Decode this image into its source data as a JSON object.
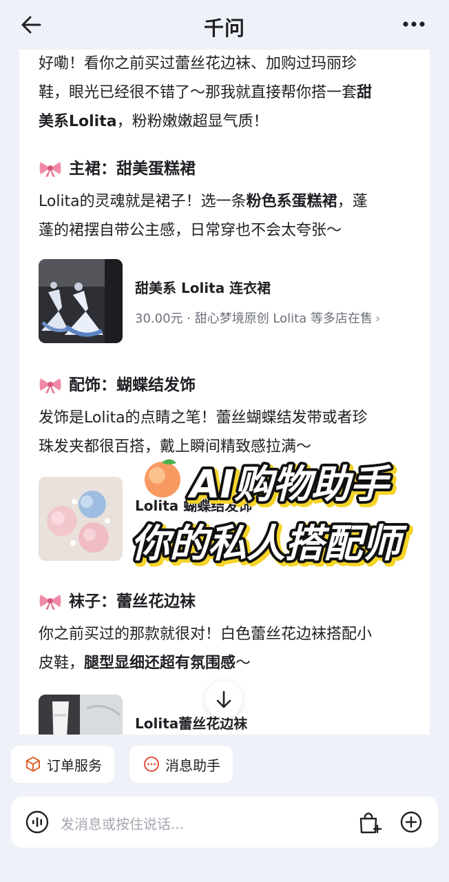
{
  "header": {
    "title": "千问"
  },
  "chat": {
    "intro_1": "好嘞！看你之前买过蕾丝花边袜、加购过玛丽珍",
    "intro_2a": "鞋，眼光已经很不错了～那我就直接帮你搭一套",
    "intro_2b": "甜",
    "intro_3a": "美系Lolita",
    "intro_3b": "，粉粉嫩嫩超显气质！",
    "sections": [
      {
        "heading": "主裙：甜美蛋糕裙",
        "line1a": "Lolita的灵魂就是裙子！选一条",
        "line1b": "粉色系蛋糕裙",
        "line1c": "，蓬",
        "line2": "蓬的裙摆自带公主感，日常穿也不会太夸张～",
        "product_name": "甜美系 Lolita 连衣裙",
        "product_meta": "30.00元 · 甜心梦境原创 Lolita 等多店在售",
        "product_arrow": "›"
      },
      {
        "heading": "配饰：蝴蝶结发饰",
        "line1": "发饰是Lolita的点睛之笔！蕾丝蝴蝶结发带或者珍",
        "line2": "珠发夹都很百搭，戴上瞬间精致感拉满～",
        "product_name": "Lolita 蝴蝶结发饰"
      },
      {
        "heading": "袜子：蕾丝花边袜",
        "line1": "你之前买过的那款就很对！白色蕾丝花边袜搭配小",
        "line2a": "皮鞋，",
        "line2b": "腿型显细还超有氛围感",
        "line2c": "～",
        "product_name": "Lolita蕾丝花边袜"
      }
    ]
  },
  "overlay": {
    "line1": "AI购物助手",
    "line2": "你的私人搭配师"
  },
  "quick_actions": [
    {
      "label": "订单服务",
      "icon": "package-icon"
    },
    {
      "label": "消息助手",
      "icon": "message-dots-icon"
    }
  ],
  "input": {
    "placeholder": "发消息或按住说话..."
  },
  "colors": {
    "background": "#eef1f7",
    "overlay_fill": "#ffffff",
    "overlay_stroke": "#111111",
    "overlay_shadow": "#f5d42a",
    "order_icon": "#e0622a",
    "message_icon": "#e34d3a"
  }
}
